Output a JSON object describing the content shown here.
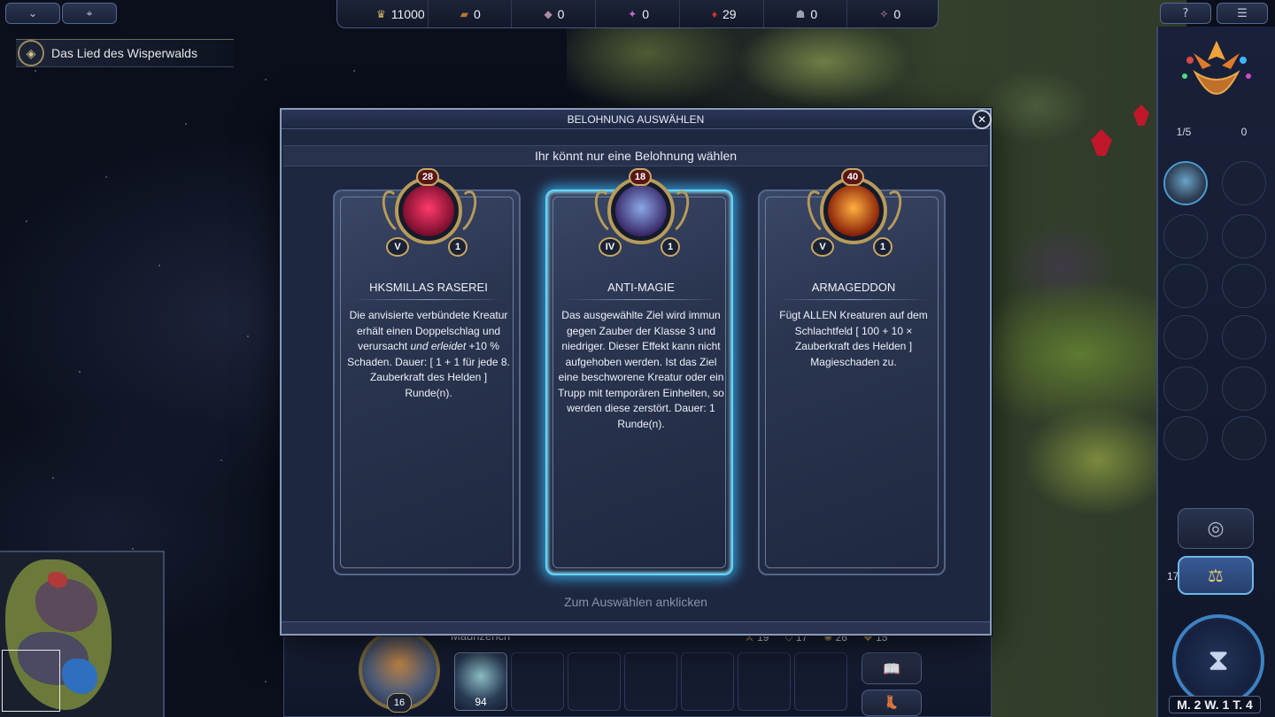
{
  "topbar": {
    "left_buttons": [
      {
        "icon": "chevron-down-icon",
        "glyph": "⌄"
      },
      {
        "icon": "map-pin-icon",
        "glyph": "⌖"
      }
    ],
    "resources": [
      {
        "icon": "gold-icon",
        "glyph": "♛",
        "value": "11000",
        "color": "#d4b266"
      },
      {
        "icon": "wood-icon",
        "glyph": "▰",
        "value": "0",
        "color": "#b8743c"
      },
      {
        "icon": "ore-icon",
        "glyph": "◆",
        "value": "0",
        "color": "#b08aa0"
      },
      {
        "icon": "gems-icon",
        "glyph": "✦",
        "value": "0",
        "color": "#c36ac8"
      },
      {
        "icon": "crystal-icon",
        "glyph": "♦",
        "value": "29",
        "color": "#d03030"
      },
      {
        "icon": "mercury-icon",
        "glyph": "☗",
        "value": "0",
        "color": "#9aa2b0"
      },
      {
        "icon": "dust-icon",
        "glyph": "✧",
        "value": "0",
        "color": "#c890a8"
      }
    ],
    "right_buttons": [
      {
        "icon": "help-icon",
        "glyph": "?"
      },
      {
        "icon": "menu-icon",
        "glyph": "☰"
      }
    ]
  },
  "quest": {
    "title": "Das Lied des Wisperwalds",
    "icon": "compass-icon"
  },
  "dialog": {
    "title": "BELOHNUNG AUSWÄHLEN",
    "close_label": "✕",
    "subtitle": "Ihr könnt nur eine Belohnung wählen",
    "footer": "Zum Auswählen anklicken",
    "cards": [
      {
        "name": "HKSMILLAS RASEREI",
        "level": "28",
        "class": "V",
        "count": "1",
        "selected": false,
        "art_colors": [
          "#ff3a6a",
          "#7a0e2e"
        ],
        "desc_before": "Die anvisierte verbündete Kreatur erhält einen Doppelschlag und verursacht ",
        "desc_italic": "und erleidet",
        "desc_after": " +10 % Schaden. Dauer: [ 1 + 1 für jede 8. Zauberkraft des Helden ] Runde(n)."
      },
      {
        "name": "ANTI-MAGIE",
        "level": "18",
        "class": "IV",
        "count": "1",
        "selected": true,
        "art_colors": [
          "#8aa8e8",
          "#3a2a6a"
        ],
        "desc_before": "Das ausgewählte Ziel wird immun gegen Zauber der Klasse 3 und niedriger. Dieser Effekt kann nicht aufgehoben werden. Ist das Ziel eine beschworene Kreatur oder ein Trupp mit temporären Einheiten, so werden diese zerstört. Dauer: 1 Runde(n).",
        "desc_italic": "",
        "desc_after": ""
      },
      {
        "name": "ARMAGEDDON",
        "level": "40",
        "class": "V",
        "count": "1",
        "selected": false,
        "art_colors": [
          "#ffb040",
          "#8a2208"
        ],
        "desc_before": "Fügt ALLEN Kreaturen auf dem Schlachtfeld [ 100 + 10 × Zauberkraft des Helden ] Magieschaden zu.",
        "desc_italic": "",
        "desc_after": ""
      }
    ]
  },
  "hero_bar": {
    "hero_name": "Maunzerich",
    "hero_level": "16",
    "stats": [
      {
        "icon": "attack-icon",
        "glyph": "⚔",
        "value": "19"
      },
      {
        "icon": "defense-icon",
        "glyph": "⛉",
        "value": "17"
      },
      {
        "icon": "spellpower-icon",
        "glyph": "✺",
        "value": "26"
      },
      {
        "icon": "knowledge-icon",
        "glyph": "❖",
        "value": "15"
      }
    ],
    "first_troop_count": "94",
    "empty_slots": 6
  },
  "right_panel": {
    "hero_count": "1/5",
    "town_count": "0",
    "scale_count": "17",
    "date": "M. 2  W. 1  T. 4"
  }
}
